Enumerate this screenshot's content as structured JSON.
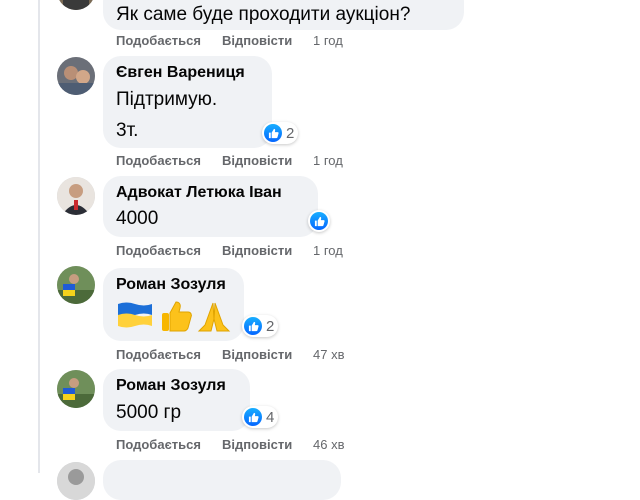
{
  "colors": {
    "bubble": "#f0f2f5",
    "meta": "#65676b",
    "like": "#0566ff"
  },
  "comments": [
    {
      "text": "Як саме буде проходити аукціон?",
      "like_label": "Подобається",
      "reply_label": "Відповісти",
      "time": "1 год"
    },
    {
      "author": "Євген Варениця",
      "line1": "Підтримую.",
      "line2": "3т.",
      "reactions": "2",
      "like_label": "Подобається",
      "reply_label": "Відповісти",
      "time": "1 год"
    },
    {
      "author": "Адвокат Летюка Іван",
      "text": "4000",
      "like_label": "Подобається",
      "reply_label": "Відповісти",
      "time": "1 год"
    },
    {
      "author": "Роман Зозуля",
      "emoji": [
        "ukraine-flag",
        "thumbs-up",
        "folded-hands"
      ],
      "reactions": "2",
      "like_label": "Подобається",
      "reply_label": "Відповісти",
      "time": "47 хв"
    },
    {
      "author": "Роман Зозуля",
      "text": "5000 гр",
      "reactions": "4",
      "like_label": "Подобається",
      "reply_label": "Відповісти",
      "time": "46 хв"
    }
  ]
}
